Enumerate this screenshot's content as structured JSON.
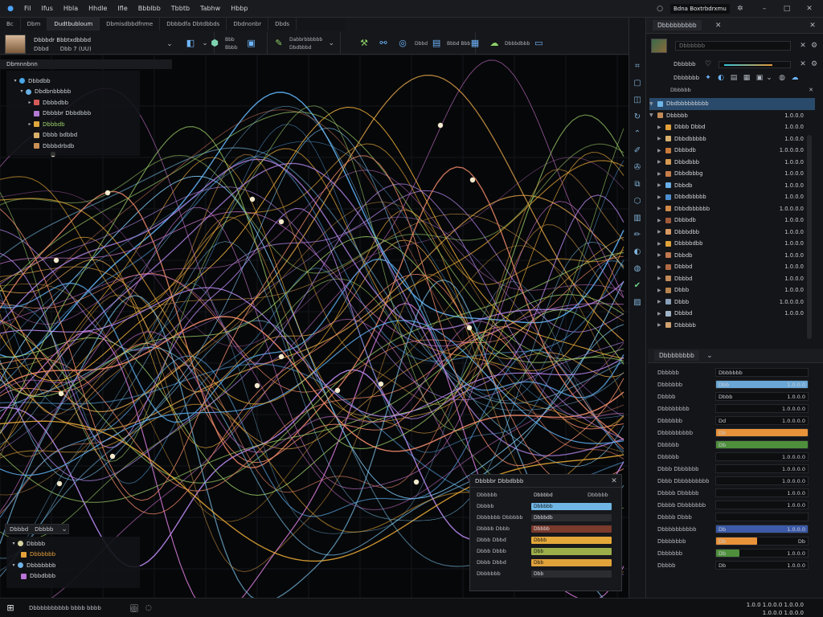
{
  "titlebar": {
    "app_title": "Bdna Boxtrbdrxmu",
    "menu": [
      "Fil",
      "Ifus",
      "Hbla",
      "Hhdle",
      "Ifle",
      "Bbblbb",
      "Tbbtb",
      "Tabhw",
      "Hbbp"
    ]
  },
  "toolbar": {
    "tabs": [
      "Bc",
      "Dbm",
      "Dudtbubloum",
      "Dbmisdbbdfnme",
      "Dbbbdfa Dbtdbbds",
      "Dbdnonbr",
      "Dbds"
    ],
    "profile": {
      "line1": "Dbbbdr Bbbtxdbbbd",
      "line2_a": "Dbbd",
      "line2_b": "Dbb 7 (UU)"
    },
    "groups": [
      {
        "labels": [
          "",
          ""
        ]
      },
      {
        "labels": [
          "Bbb",
          "Bbbb"
        ]
      },
      {
        "labels": [
          "Dabbrbbbbbb",
          "Dbdbbbd"
        ]
      },
      {
        "labels": [
          "Dbbd",
          "Bbbd Bbb"
        ]
      },
      {
        "labels": [
          "Dbbbdbbb",
          ""
        ]
      }
    ]
  },
  "outliner": {
    "title": "Dbmnnbnn",
    "items": [
      {
        "label": "Dbbdbb",
        "color": "#49a7e8"
      },
      {
        "label": "Dbdbnbbbbb",
        "color": "#6ab0e4"
      },
      {
        "label": "Dbbbdbb",
        "color": "#d45a5a"
      },
      {
        "label": "Dbbbbr Dbbdbbb",
        "color": "#b27ad3"
      },
      {
        "label": "Dbbbdb",
        "color": "#e0a73c"
      },
      {
        "label": "Dbbb bdbbd",
        "color": "#d9b06a"
      },
      {
        "label": "Dbbbdrbdb",
        "color": "#c98f55"
      }
    ]
  },
  "bottom_left": {
    "title": "Dbbbd",
    "title2": "Dbbbb",
    "items": [
      {
        "label": "Dbbbb",
        "color": "#d6d3a2"
      },
      {
        "label": "Dbbbbbb",
        "color": "#e4a03a",
        "text_color": "#e7a13c"
      },
      {
        "label": "Dbbbbbbb",
        "color": "#6fb3e8"
      },
      {
        "label": "Dbbdbbb",
        "color": "#b874d6"
      }
    ]
  },
  "dialog": {
    "title": "Dbbbbr Dbbdbbb",
    "rows": [
      {
        "label": "Dbbbbb",
        "value": "Dbbbbd",
        "color": "",
        "right": "Dbbbbb"
      },
      {
        "label": "Dbbbb",
        "value": "Dbbbbb",
        "color": "#6fb6e4",
        "right": ""
      },
      {
        "label": "Dbbbbbb Dbbbbb",
        "value": "Dbbbdb",
        "color": "#2a2c30",
        "right": ""
      },
      {
        "label": "Dbbbb Dbbb",
        "value": "Dbbbb",
        "color": "#7a3a2c",
        "right": ""
      },
      {
        "label": "Dbbb Dbbd",
        "value": "Dbbb",
        "color": "#e4a83a",
        "right": ""
      },
      {
        "label": "Dbbb Dbbb",
        "value": "Dbb",
        "color": "#9cae4a",
        "right": ""
      },
      {
        "label": "Dbbb Dbbd",
        "value": "Dbb",
        "color": "#e0a23a",
        "right": ""
      },
      {
        "label": "Dbbbbbb",
        "value": "Dbb",
        "color": "#2a2c30",
        "right": ""
      }
    ]
  },
  "right_panel": {
    "header": "Dbbbbbbbbb",
    "search_placeholder": "Dbbbbbb",
    "filter_label": "Dbbbbb",
    "filter_label2": "Dbbbbbb",
    "collection": {
      "label": "Dbdbbbbbbbbb",
      "caption": "Dbbbbb"
    },
    "tree_root": "Dbbbbb",
    "tree_root_value": "1.0.0.0",
    "tree": [
      {
        "label": "Dbbb Dbbd",
        "value": "1.0.0.0",
        "color": "#e2a03a"
      },
      {
        "label": "Dbbdbbbbb",
        "value": "1.0.0.0",
        "color": "#d8b070"
      },
      {
        "label": "Dbbbdb",
        "value": "1.0.0.0.0",
        "color": "#c77a3a"
      },
      {
        "label": "Dbbdbbb",
        "value": "1.0.0.0",
        "color": "#d49a52"
      },
      {
        "label": "Dbbdbbbg",
        "value": "1.0.0.0",
        "color": "#c87e4a"
      },
      {
        "label": "Dbbdb",
        "value": "1.0.0.0",
        "color": "#6aaee6"
      },
      {
        "label": "Dbbdbbbbb",
        "value": "1.0.0.0",
        "color": "#4c8ed0"
      },
      {
        "label": "Dbbdbbbbbb",
        "value": "1.0.0.0.0",
        "color": "#d08a4a"
      },
      {
        "label": "Dbbbdb",
        "value": "1.0.0.0",
        "color": "#a05a3a"
      },
      {
        "label": "Dbbbdbb",
        "value": "1.0.0.0",
        "color": "#d89a62"
      },
      {
        "label": "Dbbbbdbb",
        "value": "1.0.0.0",
        "color": "#e0a23a"
      },
      {
        "label": "Dbbdb",
        "value": "1.0.0.0",
        "color": "#c07850"
      },
      {
        "label": "Dbbbd",
        "value": "1.0.0.0",
        "color": "#b06a44"
      },
      {
        "label": "Dbbbd",
        "value": "1.0.0.0",
        "color": "#c08a5a"
      },
      {
        "label": "Dbbb",
        "value": "1.0.0.0",
        "color": "#b88450"
      },
      {
        "label": "Dbbb",
        "value": "1.0.0.0.0",
        "color": "#8aa0b8"
      },
      {
        "label": "Dbbbd",
        "value": "1.0.0.0",
        "color": "#a0b4c8"
      },
      {
        "label": "Dbbbbb",
        "value": "",
        "color": "#d0a070"
      }
    ],
    "props_header": "Dbbbbbbbb",
    "props": [
      {
        "label": "Dbbbbb",
        "value": "Dbbbbbb",
        "fill": "",
        "pct": 0,
        "right": ""
      },
      {
        "label": "Dbbbbbb",
        "value": "Dbb",
        "fill": "#6aa7d6",
        "pct": 100,
        "right": "1.0.0.0"
      },
      {
        "label": "Dbbbb",
        "value": "Dbbb",
        "fill": "",
        "pct": 0,
        "right": "1.0.0.0"
      },
      {
        "label": "Dbbbbbbbb",
        "value": "",
        "fill": "",
        "pct": 0,
        "right": "1.0.0.0.0"
      },
      {
        "label": "Dbbbbbb",
        "value": "Dd",
        "fill": "",
        "pct": 0,
        "right": "1.0.0.0.0"
      },
      {
        "label": "Dbbbbbbbbb",
        "value": "Db",
        "fill": "#e8923a",
        "pct": 100,
        "right": ""
      },
      {
        "label": "Dbbbbb",
        "value": "Db",
        "fill": "#4e8f3c",
        "pct": 100,
        "right": ""
      },
      {
        "label": "Dbbbbb",
        "value": "",
        "fill": "",
        "pct": 0,
        "right": "1.0.0.0.0"
      },
      {
        "label": "Dbbb Dbbbbbb",
        "value": "",
        "fill": "",
        "pct": 0,
        "right": "1.0.0.0.0"
      },
      {
        "label": "Dbbb Dbbbbbbbbb",
        "value": "",
        "fill": "",
        "pct": 0,
        "right": "1.0.0.0.0"
      },
      {
        "label": "Dbbbb Dbbbbb",
        "value": "",
        "fill": "",
        "pct": 0,
        "right": "1.0.0.0"
      },
      {
        "label": "Dbbbb Dbbbbbbb",
        "value": "",
        "fill": "",
        "pct": 0,
        "right": "1.0.0.0"
      },
      {
        "label": "Dbbbb Dbbb",
        "value": "",
        "fill": "",
        "pct": 0,
        "right": ""
      },
      {
        "label": "Dbbbbbbbbbb",
        "value": "Db",
        "fill": "#3c5aa8",
        "pct": 100,
        "right": "1.0.0.0"
      },
      {
        "label": "Dbbbbbbb",
        "value": "Db",
        "fill": "#e8923a",
        "pct": 45,
        "right": "Db"
      },
      {
        "label": "Dbbbbbb",
        "value": "Db",
        "fill": "#4e8f3c",
        "pct": 25,
        "right": "1.0.0.0"
      },
      {
        "label": "Dbbbb",
        "value": "Db",
        "fill": "",
        "pct": 0,
        "right": "1.0.0.0"
      }
    ]
  },
  "taskbar": {
    "search_text": "Dbbbbbbbbbb bbbb bbbb",
    "clock_line1": "1.0.0 1.0.0.0 1.0.0.0",
    "clock_line2": "1.0.0.0 1.0.0.0"
  },
  "colors": {
    "wave_colors": [
      "#f3b23a",
      "#e6a84a",
      "#7ec8f2",
      "#5aa9e8",
      "#b98af0",
      "#d67ad8",
      "#9fd36a",
      "#f08a6a"
    ]
  }
}
